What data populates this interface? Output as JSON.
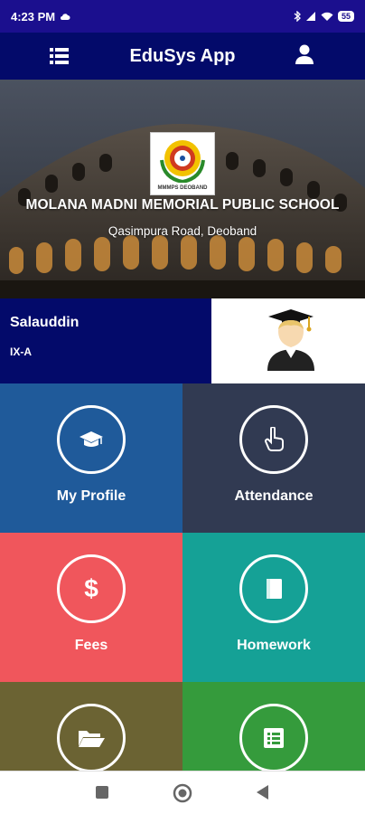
{
  "status_bar": {
    "time": "4:23 PM",
    "battery": "55"
  },
  "app_bar": {
    "title": "EduSys App",
    "menu_icon": "list-icon",
    "profile_icon": "user-icon"
  },
  "school": {
    "name": "MOLANA MADNI MEMORIAL PUBLIC SCHOOL",
    "address": "Qasimpura Road, Deoband",
    "logo_text": "MMMPS DEOBAND"
  },
  "student": {
    "name": "Salauddin",
    "class": "IX-A"
  },
  "tiles": [
    {
      "label": "My Profile",
      "icon": "graduation-cap-icon",
      "color": "#1f5a9a"
    },
    {
      "label": "Attendance",
      "icon": "hand-pointer-icon",
      "color": "#313a52"
    },
    {
      "label": "Fees",
      "icon": "dollar-icon",
      "color": "#f0565c"
    },
    {
      "label": "Homework",
      "icon": "book-icon",
      "color": "#15a196"
    },
    {
      "label": "",
      "icon": "folder-open-icon",
      "color": "#6b6333"
    },
    {
      "label": "",
      "icon": "list-alt-icon",
      "color": "#359b3c"
    }
  ],
  "colors": {
    "status_bar": "#1b0f8e",
    "app_bar": "#030a6a",
    "student_strip": "#030a6a"
  }
}
